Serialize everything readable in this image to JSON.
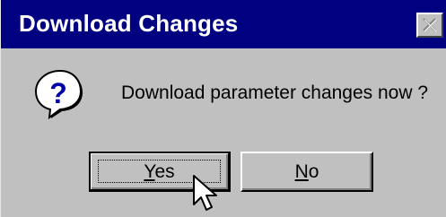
{
  "window": {
    "title": "Download Changes",
    "close_icon": "close-icon"
  },
  "content": {
    "icon": "question-icon",
    "message": "Download parameter changes now ?"
  },
  "buttons": {
    "yes": {
      "mnemonic": "Y",
      "rest": "es"
    },
    "no": {
      "mnemonic": "N",
      "rest": "o"
    }
  },
  "colors": {
    "titlebar": "#000080",
    "face": "#c0c0c0",
    "icon_blue": "#000080"
  }
}
